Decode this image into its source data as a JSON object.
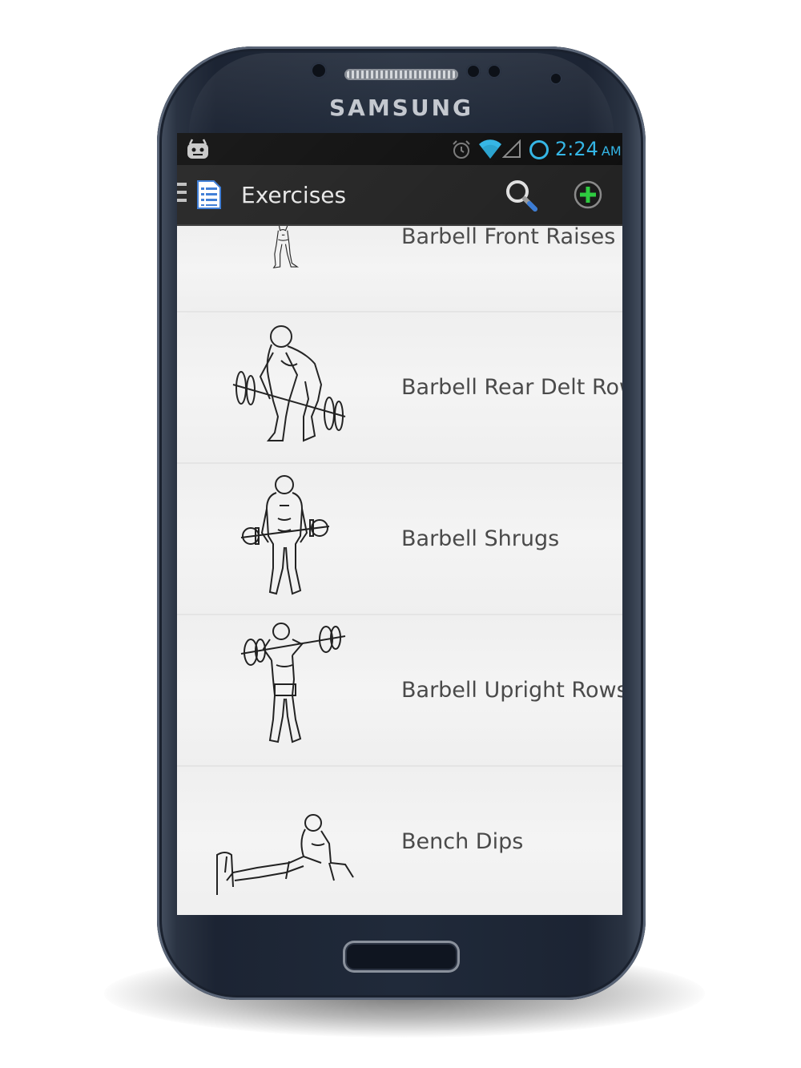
{
  "device": {
    "brand": "SAMSUNG"
  },
  "status_bar": {
    "time": "2:24",
    "ampm": "AM",
    "icons": [
      "cyanogenmod-icon",
      "alarm-icon",
      "wifi-icon",
      "signal-icon",
      "sync-icon"
    ],
    "accent": "#33b5e5"
  },
  "action_bar": {
    "title": "Exercises",
    "background": "#232323",
    "actions": [
      "search-icon",
      "add-icon"
    ],
    "add_accent": "#2ecc40"
  },
  "exercises": [
    {
      "name": "Barbell Front Raises"
    },
    {
      "name": "Barbell Rear Delt Row"
    },
    {
      "name": "Barbell Shrugs"
    },
    {
      "name": "Barbell Upright Rows"
    },
    {
      "name": "Bench Dips"
    }
  ]
}
